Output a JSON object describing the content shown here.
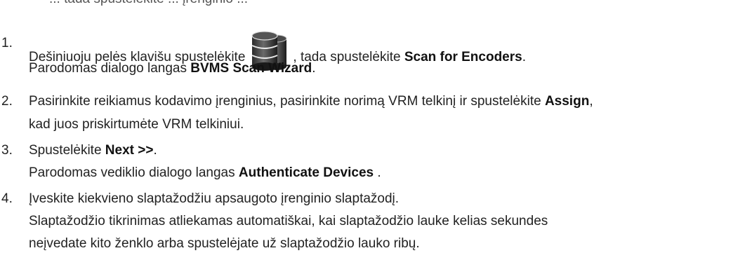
{
  "intro_fragment": "... tada spustelėkite ... įrenginio ...",
  "icon": "database-server-icon",
  "steps": [
    {
      "number": "1.",
      "line1_before_icon": "Dešiniuoju pelės klavišu spustelėkite",
      "line1_after_icon": ", tada spustelėkite ",
      "line1_bold": "Scan for Encoders",
      "line1_end": ".",
      "line2_before": "Parodomas dialogo langas ",
      "line2_bold": "BVMS Scan Wizard",
      "line2_end": "."
    },
    {
      "number": "2.",
      "line1_before": "Pasirinkite reikiamus kodavimo įrenginius, pasirinkite norimą VRM telkinį ir spustelėkite ",
      "line1_bold": "Assign",
      "line1_end": ",",
      "line2": "kad juos priskirtumėte VRM telkiniui."
    },
    {
      "number": "3.",
      "line1_before": "Spustelėkite ",
      "line1_bold": "Next >>",
      "line1_end": ".",
      "line2_before": "Parodomas vediklio dialogo langas ",
      "line2_bold": "Authenticate Devices",
      "line2_end": " ."
    },
    {
      "number": "4.",
      "line1": "Įveskite kiekvieno slaptažodžiu apsaugoto įrenginio slaptažodį.",
      "line2": "Slaptažodžio tikrinimas atliekamas automatiškai, kai slaptažodžio lauke kelias sekundes",
      "line3": "neįvedate kito ženklo arba spustelėjate už slaptažodžio lauko ribų."
    }
  ]
}
